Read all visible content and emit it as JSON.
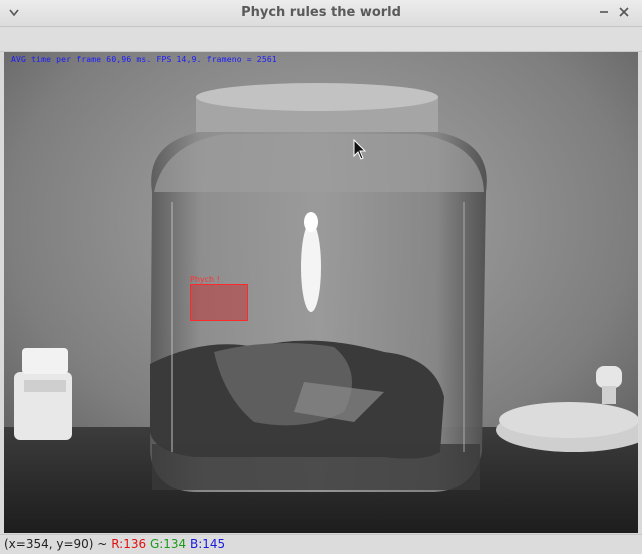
{
  "window": {
    "title": "Phych rules the world"
  },
  "overlay": {
    "stats_text": "AVG time per frame 60,96 ms. FPS 14,9. frameno = 2561"
  },
  "detection": {
    "label": "Phych !",
    "box_color": "#ff2a2a"
  },
  "status": {
    "coords": "(x=354, y=90) ~",
    "r": "R:136",
    "g": "G:134",
    "b": "B:145"
  },
  "colors": {
    "r": "#e01010",
    "g": "#1b9a1b",
    "b": "#1a1ae0"
  }
}
